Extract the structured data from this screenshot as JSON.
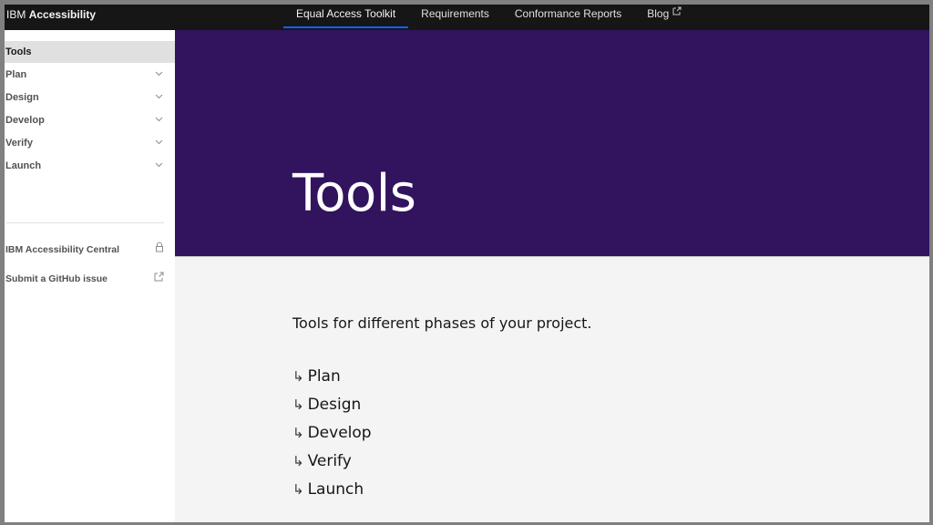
{
  "header": {
    "brand_prefix": "IBM",
    "brand_name": "Accessibility",
    "nav": [
      {
        "label": "Equal Access Toolkit",
        "active": true
      },
      {
        "label": "Requirements",
        "active": false
      },
      {
        "label": "Conformance Reports",
        "active": false
      },
      {
        "label": "Blog",
        "active": false,
        "icon": "external-link-icon"
      }
    ],
    "accent_color": "#0f62fe"
  },
  "sidebar": {
    "items": [
      {
        "label": "Tools",
        "active": true
      },
      {
        "label": "Plan",
        "icon": "chevron-down-icon"
      },
      {
        "label": "Design",
        "icon": "chevron-down-icon"
      },
      {
        "label": "Develop",
        "icon": "chevron-down-icon"
      },
      {
        "label": "Verify",
        "icon": "chevron-down-icon"
      },
      {
        "label": "Launch",
        "icon": "chevron-down-icon"
      }
    ],
    "links": [
      {
        "label": "IBM Accessibility Central",
        "icon": "lock-icon"
      },
      {
        "label": "Submit a GitHub issue",
        "icon": "external-link-icon"
      }
    ]
  },
  "hero": {
    "title": "Tools",
    "background_color": "#31135e"
  },
  "content": {
    "intro": "Tools for different phases of your project.",
    "arrow_glyph": "↳",
    "phases": [
      "Plan",
      "Design",
      "Develop",
      "Verify",
      "Launch"
    ]
  }
}
